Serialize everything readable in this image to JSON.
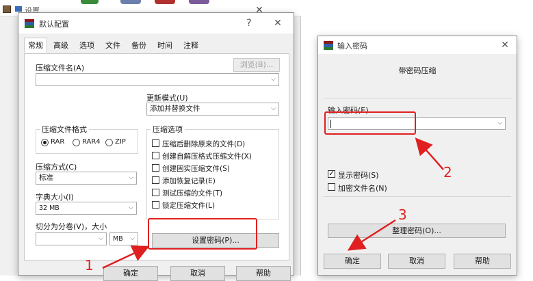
{
  "bg_window": {
    "title": "设置"
  },
  "settings_dialog": {
    "title": "默认配置",
    "help_glyph": "?",
    "close_glyph": "✕",
    "tabs": [
      "常规",
      "高级",
      "选项",
      "文件",
      "备份",
      "时间",
      "注释"
    ],
    "archive_name_label": "压缩文件名(A)",
    "browse_button": "浏览(B)...",
    "update_mode_label": "更新模式(U)",
    "update_mode_value": "添加并替换文件",
    "format_group_label": "压缩文件格式",
    "formats": [
      {
        "label": "RAR",
        "selected": true
      },
      {
        "label": "RAR4",
        "selected": false
      },
      {
        "label": "ZIP",
        "selected": false
      }
    ],
    "options_group_label": "压缩选项",
    "options": [
      {
        "label": "压缩后删除原来的文件(D)",
        "checked": false
      },
      {
        "label": "创建自解压格式压缩文件(X)",
        "checked": false
      },
      {
        "label": "创建固实压缩文件(S)",
        "checked": false
      },
      {
        "label": "添加恢复记录(E)",
        "checked": false
      },
      {
        "label": "测试压缩的文件(T)",
        "checked": false
      },
      {
        "label": "锁定压缩文件(L)",
        "checked": false
      }
    ],
    "method_label": "压缩方式(C)",
    "method_value": "标准",
    "dict_label": "字典大小(I)",
    "dict_value": "32 MB",
    "split_label": "切分为分卷(V)，大小",
    "split_unit": "MB",
    "set_password_button": "设置密码(P)...",
    "ok_button": "确定",
    "cancel_button": "取消",
    "help_button": "帮助"
  },
  "password_dialog": {
    "title": "输入密码",
    "close_glyph": "✕",
    "heading": "带密码压缩",
    "enter_password_label": "输入密码(E)",
    "password_value": "",
    "show_password_label": "显示密码(S)",
    "show_password_checked": true,
    "encrypt_names_label": "加密文件名(N)",
    "encrypt_names_checked": false,
    "organize_button": "整理密码(O)...",
    "ok_button": "确定",
    "cancel_button": "取消",
    "help_button": "帮助"
  },
  "annotations": [
    "1",
    "2",
    "3"
  ],
  "colors": {
    "annotation": "#e02020",
    "dialog_bg": "#f0f0f0"
  }
}
